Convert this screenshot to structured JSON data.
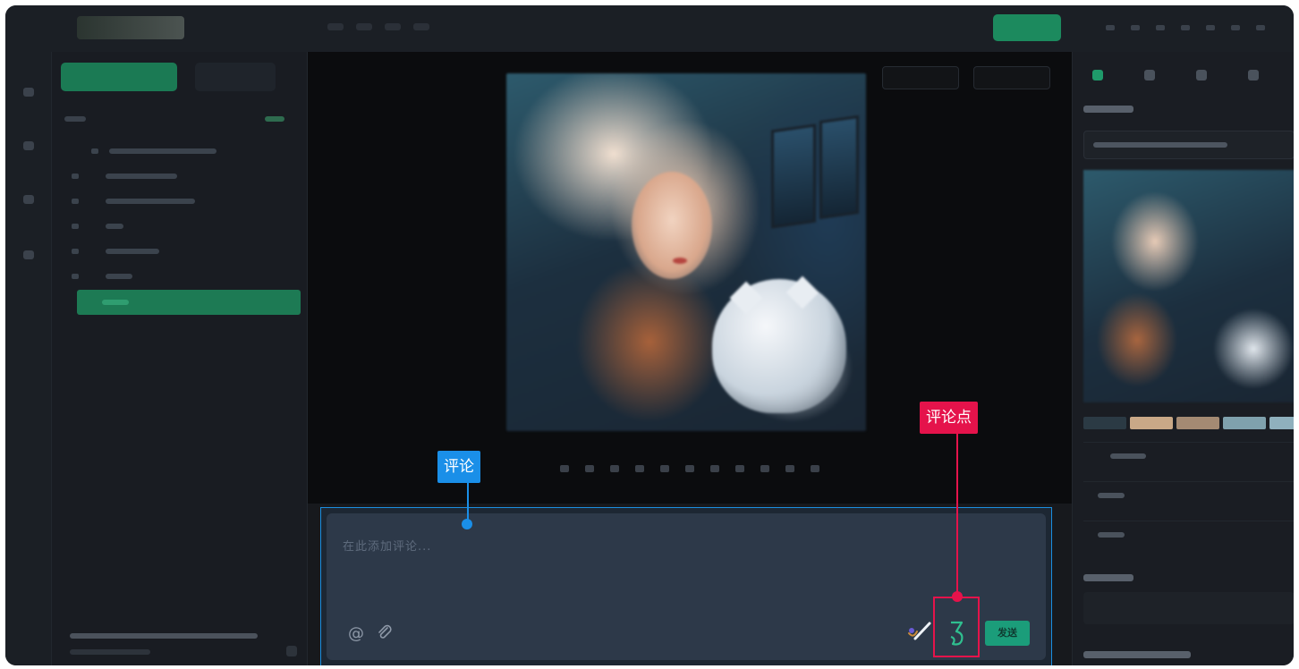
{
  "comment_panel": {
    "placeholder": "在此添加评论...",
    "send_label": "发送"
  },
  "annotations": {
    "comment_label": "评论",
    "comment_point_label": "评论点"
  },
  "colors": {
    "accent": "#1b9d7a",
    "annotation_blue": "#1a8fe8",
    "annotation_red": "#e5134b",
    "swatches": [
      "#2b3a44",
      "#c9a887",
      "#a48a73",
      "#7fa1ad",
      "#8fb0bd"
    ]
  },
  "icons": [
    "at-icon",
    "paperclip-icon",
    "pen-icon",
    "brush-icon"
  ]
}
